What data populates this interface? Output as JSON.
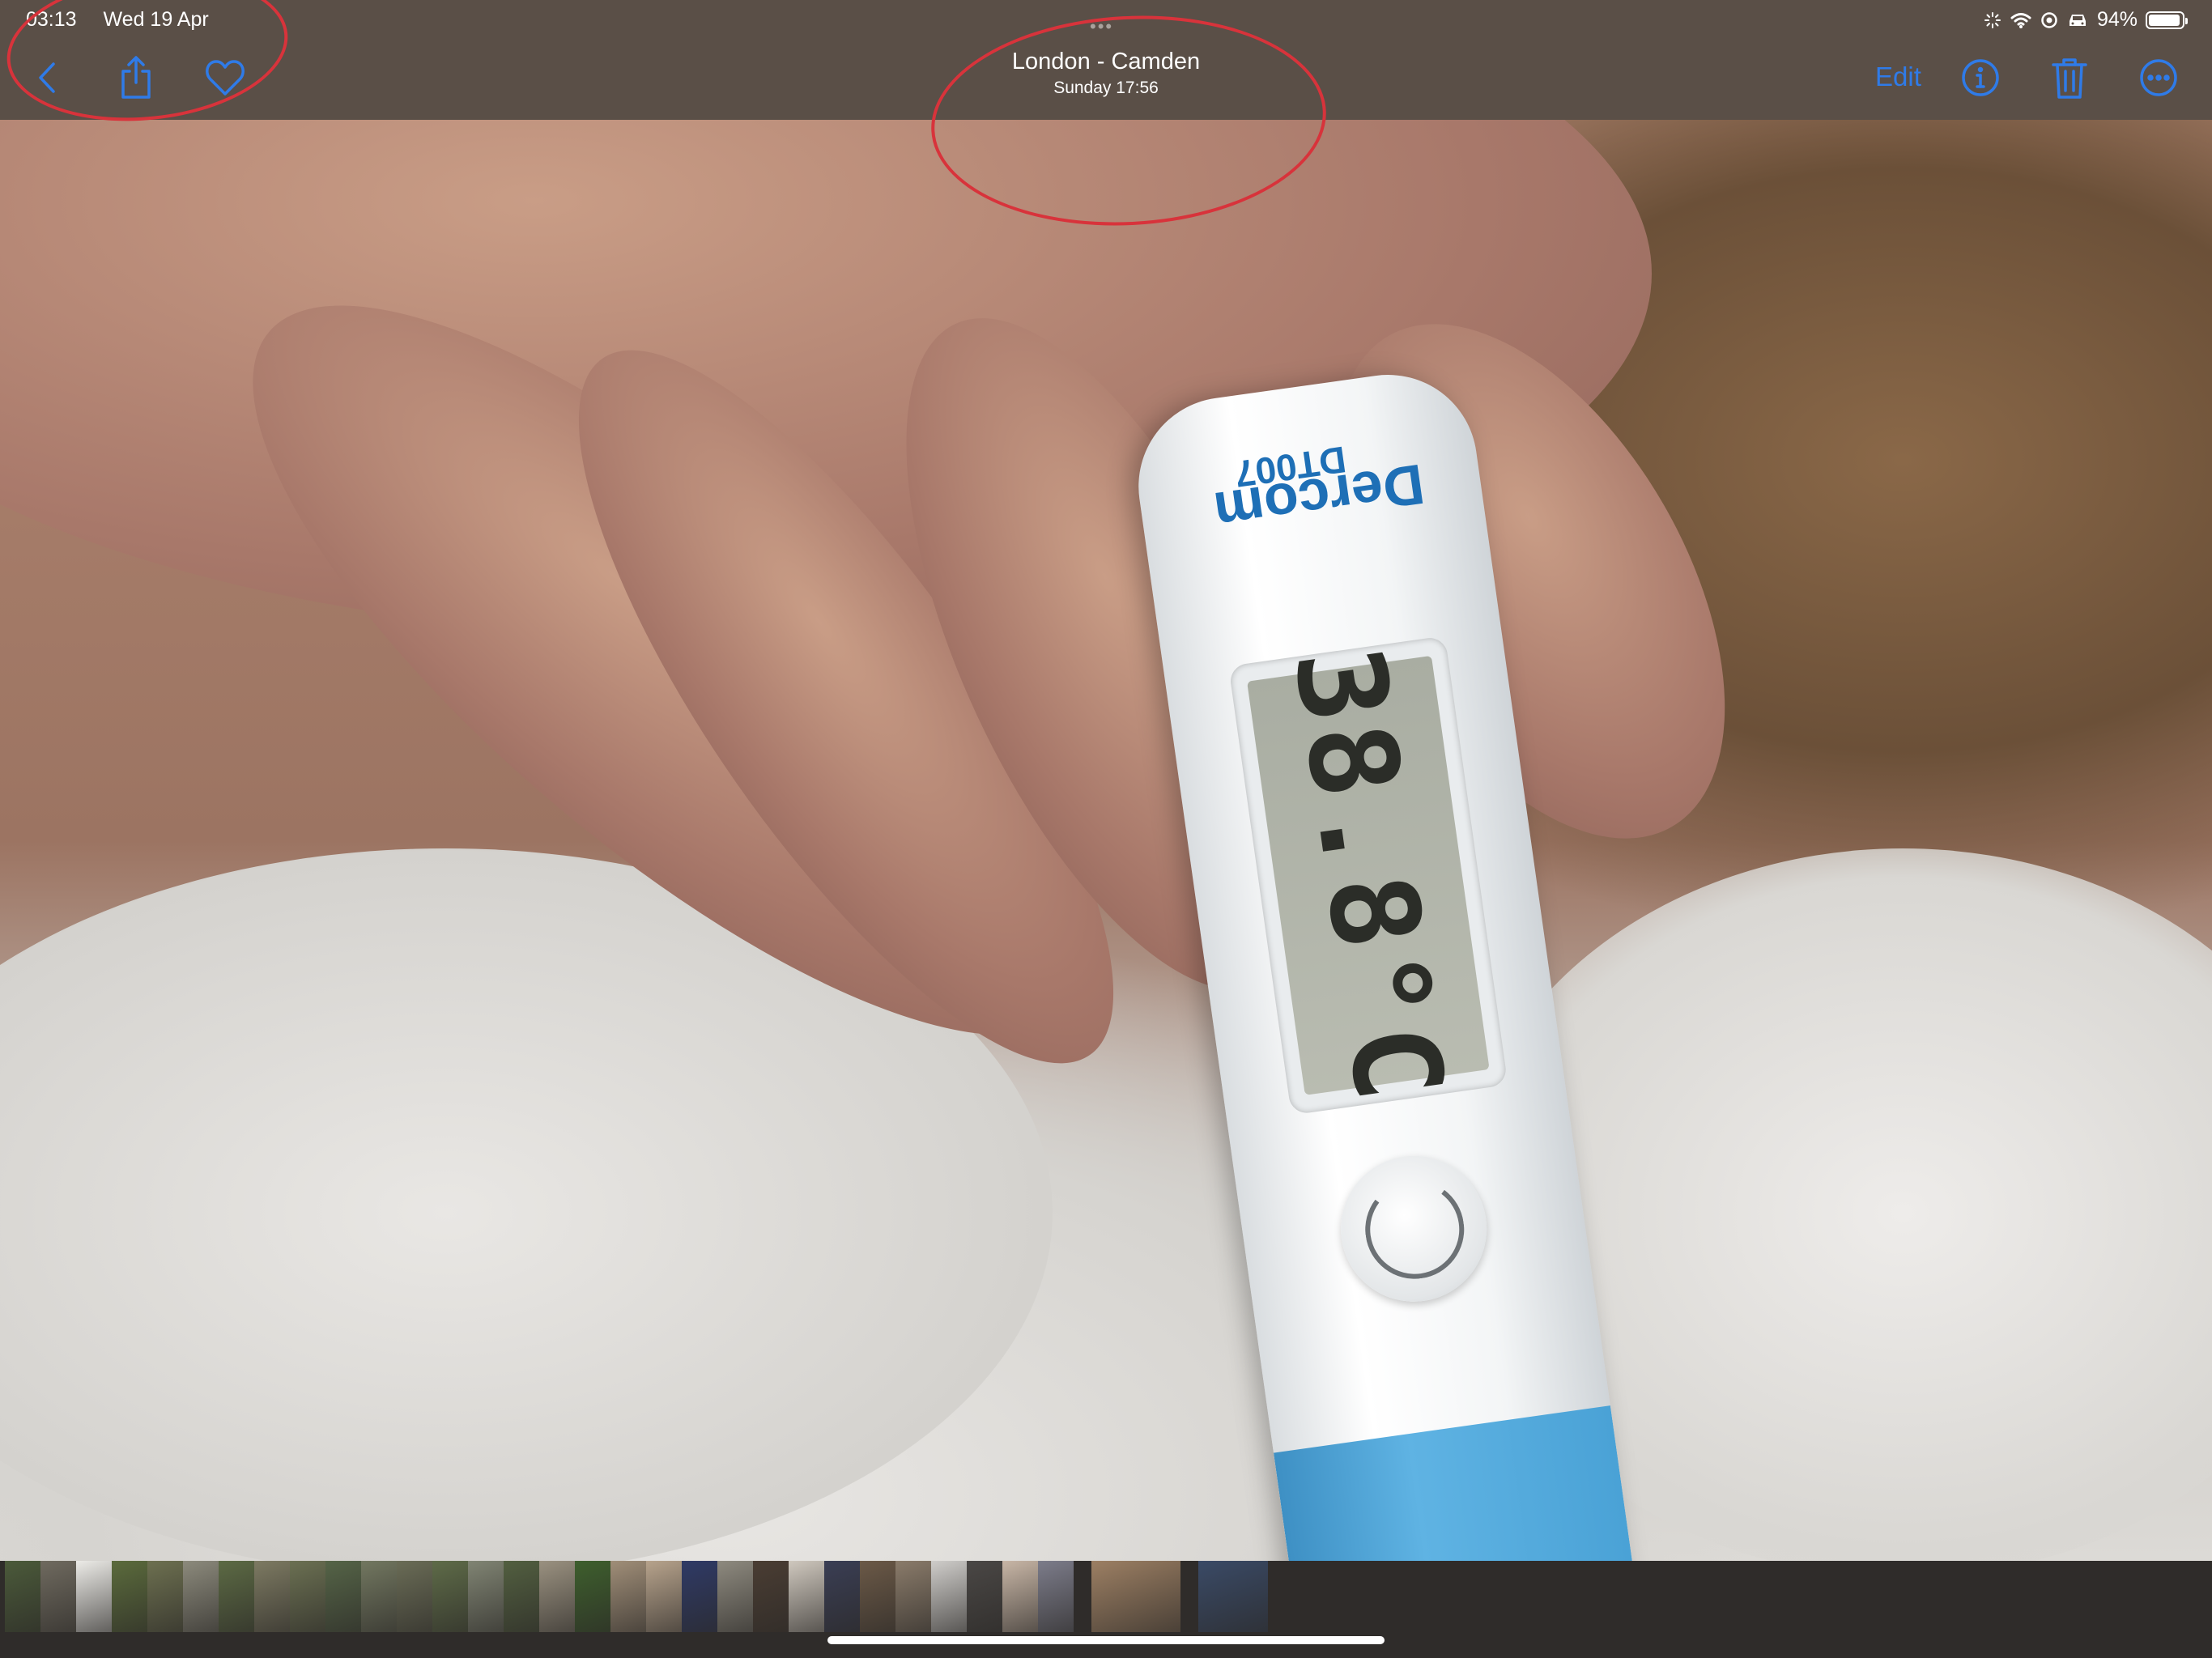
{
  "status_bar": {
    "time": "03:13",
    "date": "Wed 19 Apr",
    "battery_level": 0.94,
    "battery_percent": "94%",
    "icons": [
      "activity-icon",
      "wifi-icon",
      "location-icon",
      "car-icon",
      "battery-icon"
    ]
  },
  "nav": {
    "left_icons": [
      "back-chevron-icon",
      "share-icon",
      "heart-icon"
    ],
    "title": "London - Camden",
    "subtitle": "Sunday  17:56",
    "grabber": "•••",
    "edit_label": "Edit",
    "right_icons": [
      "info-icon",
      "trash-icon",
      "more-icon"
    ]
  },
  "photo": {
    "thermometer_brand": "Dercom",
    "thermometer_model": "DT007",
    "display_reading": "38.8°C"
  },
  "colors": {
    "accent": "#2f7be8",
    "toolbar_bg": "#5a4f47",
    "annotation": "#d8333b",
    "filmstrip_bg": "#2f2c2a"
  },
  "filmstrip": {
    "thumbnail_colors": [
      "#4b5a3a",
      "#6f6a5f",
      "#ecebe7",
      "#5b6b3c",
      "#6d7050",
      "#8c8a7c",
      "#5c6a44",
      "#7d7a62",
      "#6b7052",
      "#556447",
      "#727760",
      "#6a6c56",
      "#5e6b48",
      "#808473",
      "#525f40",
      "#9a9180",
      "#3e5f2d",
      "#a08e78",
      "#b7a38c",
      "#2f3a66",
      "#8e8a7f",
      "#4a3d33",
      "#cfc8be",
      "#3a3e54",
      "#6b5947",
      "#8a7b6a",
      "#cfcdca",
      "#4a4745",
      "#c8b6a6",
      "#7c7c8a",
      "#9c7f63",
      "#3a4a66"
    ]
  }
}
